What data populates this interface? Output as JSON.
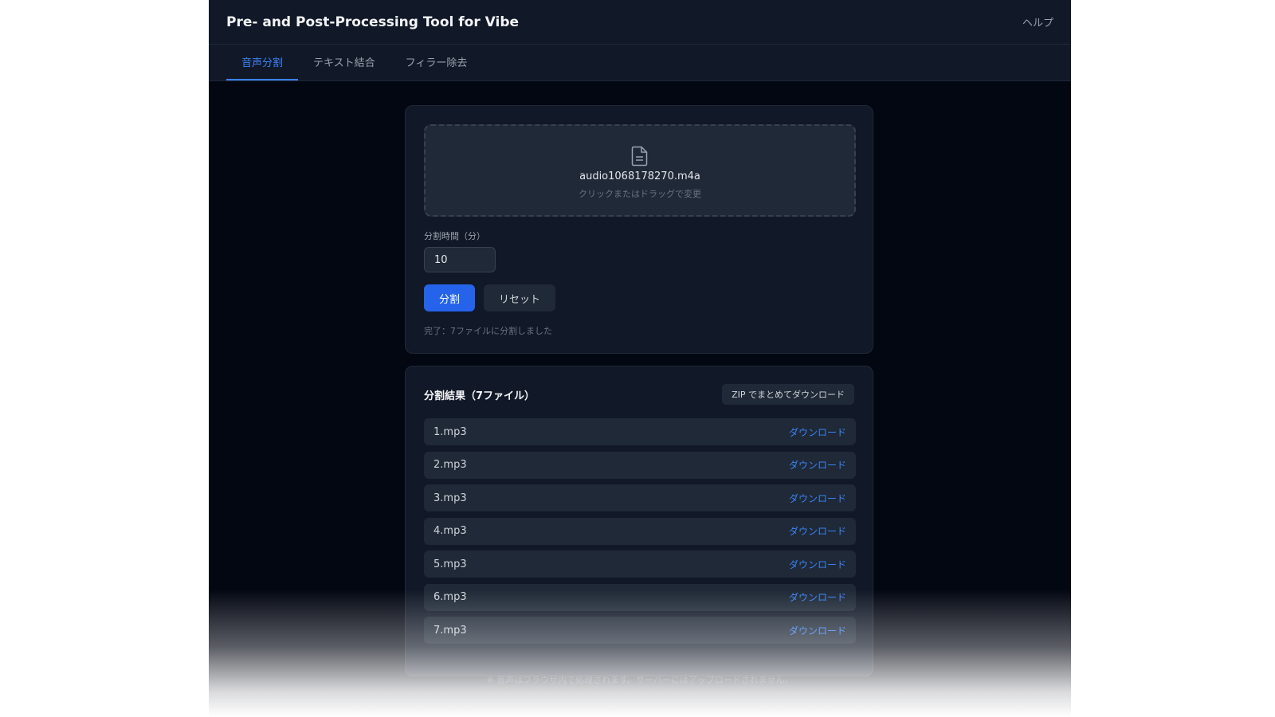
{
  "header": {
    "title": "Pre- and Post-Processing Tool for Vibe",
    "help_label": "ヘルプ"
  },
  "tabs": [
    {
      "label": "音声分割",
      "active": true
    },
    {
      "label": "テキスト結合",
      "active": false
    },
    {
      "label": "フィラー除去",
      "active": false
    }
  ],
  "split": {
    "file_name": "audio1068178270.m4a",
    "drop_hint": "クリックまたはドラッグで変更",
    "minutes_label": "分割時間（分）",
    "minutes_value": "10",
    "split_button": "分割",
    "reset_button": "リセット",
    "status": "完了：7ファイルに分割しました"
  },
  "results": {
    "title": "分割結果（7ファイル）",
    "zip_button": "ZIP でまとめてダウンロード",
    "download_label": "ダウンロード",
    "files": [
      "1.mp3",
      "2.mp3",
      "3.mp3",
      "4.mp3",
      "5.mp3",
      "6.mp3",
      "7.mp3"
    ]
  },
  "footer": {
    "note": "※ 音声はブラウザ内で処理されます。サーバーにはアップロードされません。"
  },
  "colors": {
    "accent": "#2563eb",
    "link": "#3b82f6",
    "background": "#030712",
    "card": "#111827"
  },
  "icons": {
    "file": "file-text-icon"
  }
}
